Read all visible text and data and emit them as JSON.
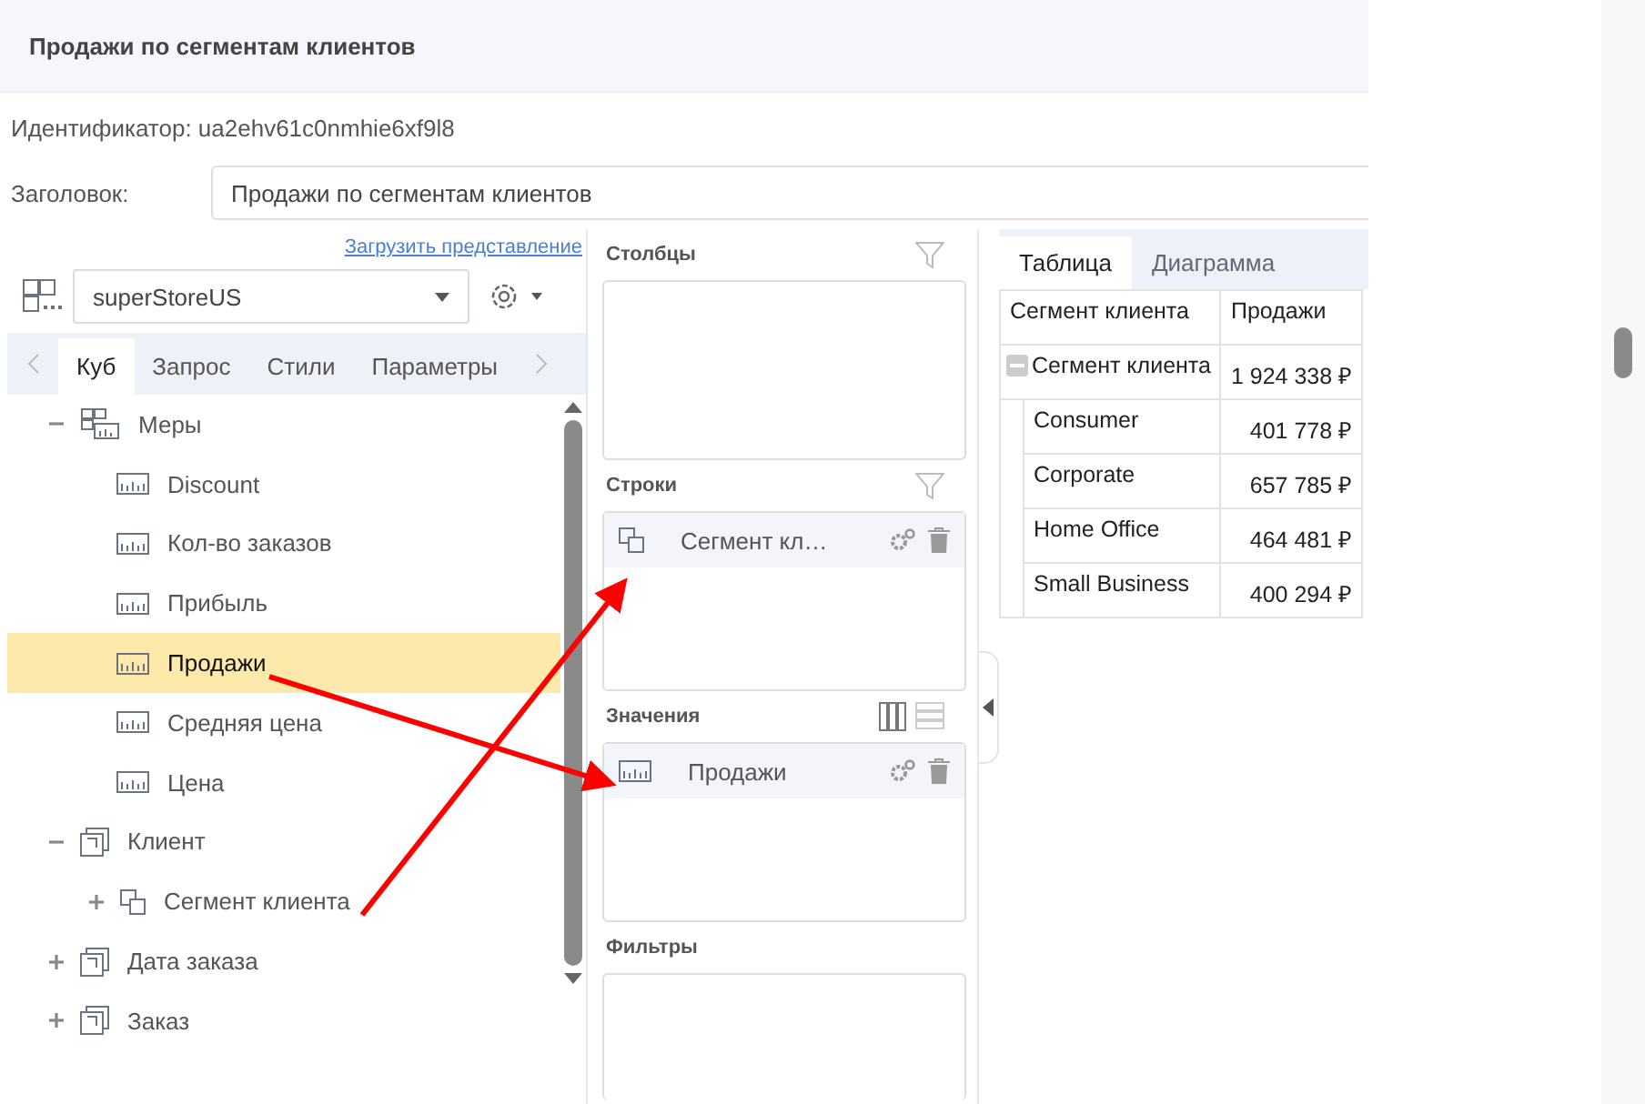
{
  "header": {
    "title": "Продажи по сегментам клиентов"
  },
  "identifier": "Идентификатор: ua2ehv61c0nmhie6xf9l8",
  "caption": {
    "label": "Заголовок:",
    "value": "Продажи по сегментам клиентов"
  },
  "load_view_link": "Загрузить представление",
  "cube_select": {
    "value": "superStoreUS"
  },
  "left_tabs": [
    {
      "label": "Куб",
      "selected": true
    },
    {
      "label": "Запрос",
      "selected": false
    },
    {
      "label": "Стили",
      "selected": false
    },
    {
      "label": "Параметры",
      "selected": false
    }
  ],
  "tree": [
    {
      "label": "Меры",
      "kind": "measures",
      "expanded": true,
      "selected": false,
      "children": [
        {
          "label": "Discount",
          "kind": "measure",
          "selected": false
        },
        {
          "label": "Кол-во заказов",
          "kind": "measure",
          "selected": false
        },
        {
          "label": "Прибыль",
          "kind": "measure",
          "selected": false
        },
        {
          "label": "Продажи",
          "kind": "measure",
          "selected": true
        },
        {
          "label": "Средняя цена",
          "kind": "measure",
          "selected": false
        },
        {
          "label": "Цена",
          "kind": "measure",
          "selected": false
        }
      ]
    },
    {
      "label": "Клиент",
      "kind": "dimension",
      "expanded": true,
      "selected": false,
      "children": [
        {
          "label": "Сегмент клиента",
          "kind": "attribute",
          "expanded": false,
          "selected": false
        }
      ]
    },
    {
      "label": "Дата заказа",
      "kind": "dimension",
      "expanded": false,
      "selected": false
    },
    {
      "label": "Заказ",
      "kind": "dimension",
      "expanded": false,
      "selected": false
    }
  ],
  "zones": [
    {
      "title": "Столбцы",
      "kind": "filter"
    },
    {
      "title": "Строки",
      "kind": "filter",
      "items": [
        {
          "label": "Сегмент кл…",
          "kind": "attribute"
        }
      ]
    },
    {
      "title": "Значения",
      "kind": "layout",
      "items": [
        {
          "label": "Продажи",
          "kind": "measure"
        }
      ]
    },
    {
      "title": "Фильтры",
      "kind": "plain"
    }
  ],
  "right_tabs": [
    {
      "label": "Таблица",
      "selected": true
    },
    {
      "label": "Диаграмма",
      "selected": false
    }
  ],
  "table": {
    "columns": [
      "Сегмент клиента",
      "Продажи"
    ],
    "total": {
      "label": "Сегмент клиента",
      "value": "1 924 338 ₽",
      "expanded": true
    },
    "rows": [
      {
        "label": "Consumer",
        "value": "401 778 ₽"
      },
      {
        "label": "Corporate",
        "value": "657 785 ₽"
      },
      {
        "label": "Home Office",
        "value": "464 481 ₽"
      },
      {
        "label": "Small Business",
        "value": "400 294 ₽"
      }
    ]
  }
}
